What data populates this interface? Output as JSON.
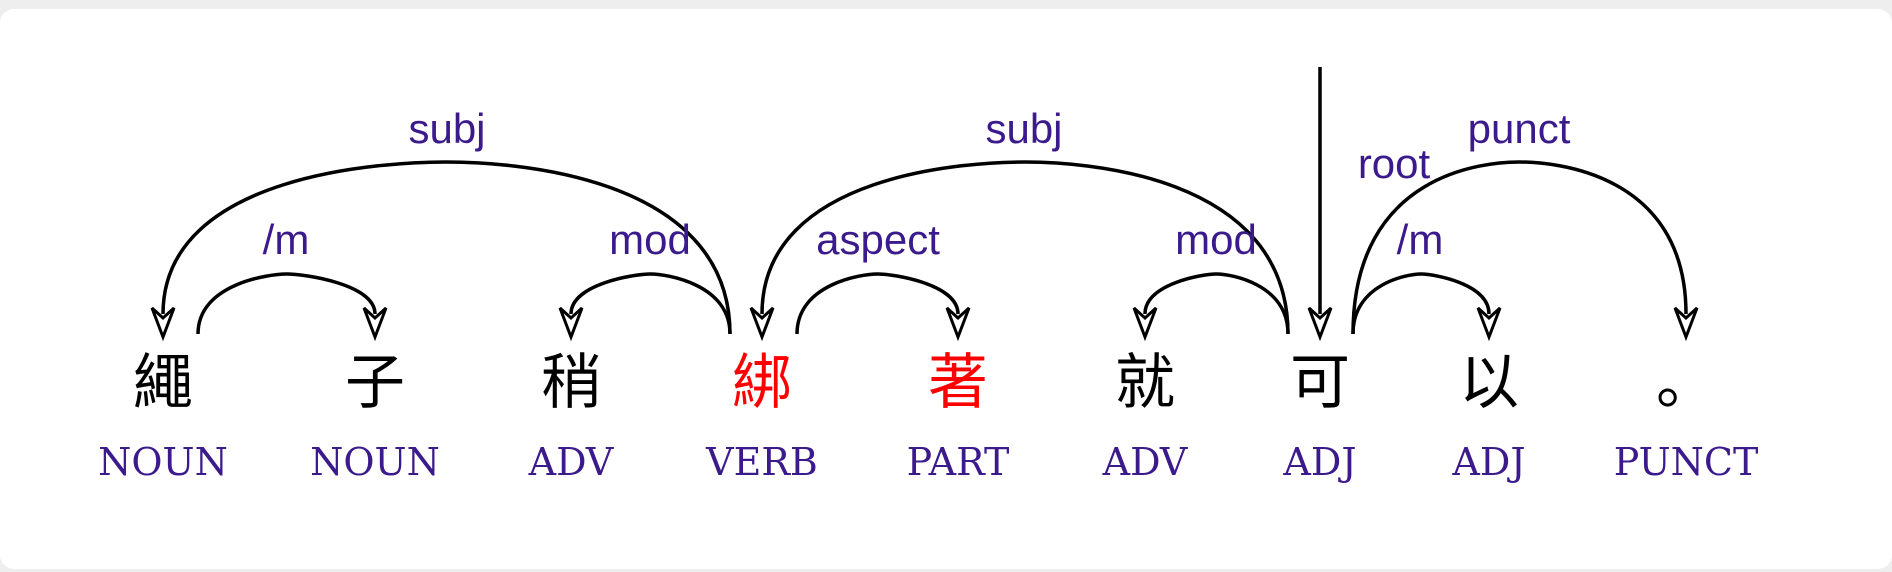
{
  "diagram": {
    "words": [
      {
        "text": "繩",
        "pos": "NOUN",
        "highlight": false
      },
      {
        "text": "子",
        "pos": "NOUN",
        "highlight": false
      },
      {
        "text": "稍",
        "pos": "ADV",
        "highlight": false
      },
      {
        "text": "綁",
        "pos": "VERB",
        "highlight": true
      },
      {
        "text": "著",
        "pos": "PART",
        "highlight": true
      },
      {
        "text": "就",
        "pos": "ADV",
        "highlight": false
      },
      {
        "text": "可",
        "pos": "ADJ",
        "highlight": false
      },
      {
        "text": "以",
        "pos": "ADJ",
        "highlight": false
      },
      {
        "text": "。",
        "pos": "PUNCT",
        "highlight": false
      }
    ],
    "arcs": [
      {
        "label": "subj",
        "from": 3,
        "to": 0
      },
      {
        "label": "/m",
        "from": 0,
        "to": 1
      },
      {
        "label": "mod",
        "from": 3,
        "to": 2
      },
      {
        "label": "subj",
        "from": 6,
        "to": 3
      },
      {
        "label": "aspect",
        "from": 3,
        "to": 4
      },
      {
        "label": "mod",
        "from": 6,
        "to": 5
      },
      {
        "label": "/m",
        "from": 6,
        "to": 7
      },
      {
        "label": "punct",
        "from": 6,
        "to": 8
      }
    ],
    "root": {
      "label": "root",
      "word": 6
    },
    "colors": {
      "word": "#000000",
      "highlight": "#ff0000",
      "label": "#3b1a8c"
    }
  }
}
